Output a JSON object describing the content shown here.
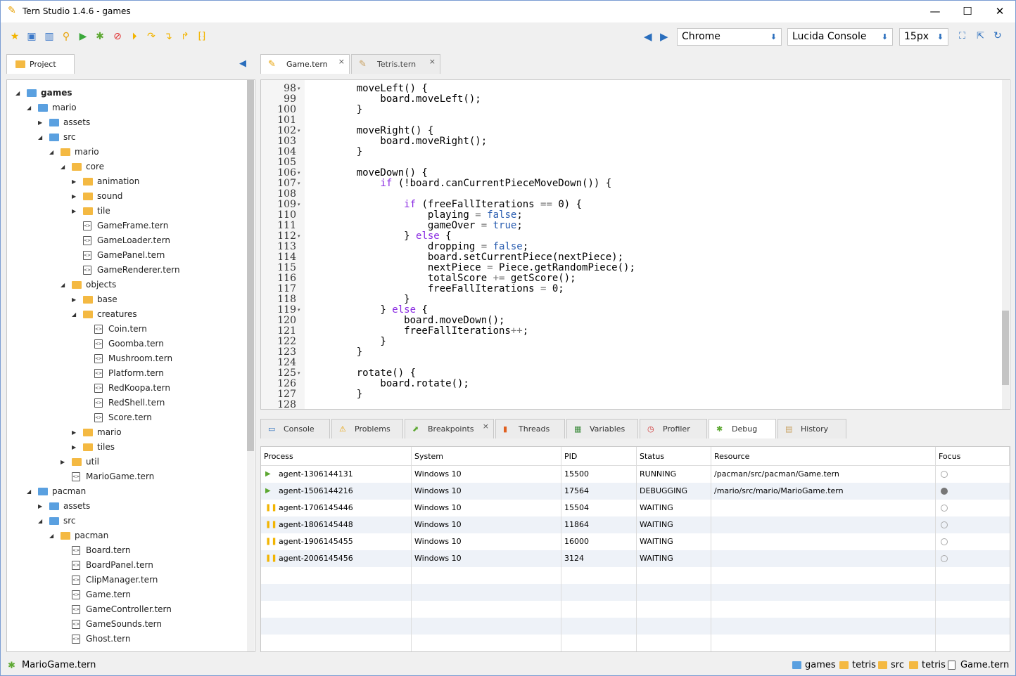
{
  "window": {
    "title": "Tern Studio 1.4.6 - games",
    "minimize": "—",
    "maximize": "☐",
    "close": "✕"
  },
  "toolbar": {
    "browser_select": "Chrome",
    "font_select": "Lucida Console",
    "size_select": "15px"
  },
  "project_panel": {
    "tab_label": "Project"
  },
  "tree": [
    {
      "label": "games",
      "depth": 0,
      "kind": "folder-blue",
      "twisty": "open",
      "bold": true
    },
    {
      "label": "mario",
      "depth": 1,
      "kind": "folder-blue",
      "twisty": "open"
    },
    {
      "label": "assets",
      "depth": 2,
      "kind": "folder-blue",
      "twisty": "closed"
    },
    {
      "label": "src",
      "depth": 2,
      "kind": "folder-blue",
      "twisty": "open"
    },
    {
      "label": "mario",
      "depth": 3,
      "kind": "folder",
      "twisty": "open"
    },
    {
      "label": "core",
      "depth": 4,
      "kind": "folder",
      "twisty": "open"
    },
    {
      "label": "animation",
      "depth": 5,
      "kind": "folder",
      "twisty": "closed"
    },
    {
      "label": "sound",
      "depth": 5,
      "kind": "folder",
      "twisty": "closed"
    },
    {
      "label": "tile",
      "depth": 5,
      "kind": "folder",
      "twisty": "closed"
    },
    {
      "label": "GameFrame.tern",
      "depth": 5,
      "kind": "file"
    },
    {
      "label": "GameLoader.tern",
      "depth": 5,
      "kind": "file"
    },
    {
      "label": "GamePanel.tern",
      "depth": 5,
      "kind": "file"
    },
    {
      "label": "GameRenderer.tern",
      "depth": 5,
      "kind": "file"
    },
    {
      "label": "objects",
      "depth": 4,
      "kind": "folder",
      "twisty": "open"
    },
    {
      "label": "base",
      "depth": 5,
      "kind": "folder",
      "twisty": "closed"
    },
    {
      "label": "creatures",
      "depth": 5,
      "kind": "folder",
      "twisty": "open"
    },
    {
      "label": "Coin.tern",
      "depth": 6,
      "kind": "file"
    },
    {
      "label": "Goomba.tern",
      "depth": 6,
      "kind": "file"
    },
    {
      "label": "Mushroom.tern",
      "depth": 6,
      "kind": "file"
    },
    {
      "label": "Platform.tern",
      "depth": 6,
      "kind": "file"
    },
    {
      "label": "RedKoopa.tern",
      "depth": 6,
      "kind": "file"
    },
    {
      "label": "RedShell.tern",
      "depth": 6,
      "kind": "file"
    },
    {
      "label": "Score.tern",
      "depth": 6,
      "kind": "file"
    },
    {
      "label": "mario",
      "depth": 5,
      "kind": "folder",
      "twisty": "closed"
    },
    {
      "label": "tiles",
      "depth": 5,
      "kind": "folder",
      "twisty": "closed"
    },
    {
      "label": "util",
      "depth": 4,
      "kind": "folder",
      "twisty": "closed"
    },
    {
      "label": "MarioGame.tern",
      "depth": 4,
      "kind": "file"
    },
    {
      "label": "pacman",
      "depth": 1,
      "kind": "folder-blue",
      "twisty": "open"
    },
    {
      "label": "assets",
      "depth": 2,
      "kind": "folder-blue",
      "twisty": "closed"
    },
    {
      "label": "src",
      "depth": 2,
      "kind": "folder-blue",
      "twisty": "open"
    },
    {
      "label": "pacman",
      "depth": 3,
      "kind": "folder",
      "twisty": "open"
    },
    {
      "label": "Board.tern",
      "depth": 4,
      "kind": "file"
    },
    {
      "label": "BoardPanel.tern",
      "depth": 4,
      "kind": "file"
    },
    {
      "label": "ClipManager.tern",
      "depth": 4,
      "kind": "file"
    },
    {
      "label": "Game.tern",
      "depth": 4,
      "kind": "file"
    },
    {
      "label": "GameController.tern",
      "depth": 4,
      "kind": "file"
    },
    {
      "label": "GameSounds.tern",
      "depth": 4,
      "kind": "file"
    },
    {
      "label": "Ghost.tern",
      "depth": 4,
      "kind": "file"
    }
  ],
  "editor_tabs": [
    {
      "label": "Game.tern",
      "active": true,
      "close": "×"
    },
    {
      "label": "Tetris.tern",
      "active": false,
      "close": "×"
    }
  ],
  "code": [
    {
      "n": "98",
      "fold": true,
      "t": "    moveLeft() {"
    },
    {
      "n": "99",
      "fold": false,
      "t": "        board.moveLeft();"
    },
    {
      "n": "100",
      "fold": false,
      "t": "    }"
    },
    {
      "n": "101",
      "fold": false,
      "t": ""
    },
    {
      "n": "102",
      "fold": true,
      "t": "    moveRight() {"
    },
    {
      "n": "103",
      "fold": false,
      "t": "        board.moveRight();"
    },
    {
      "n": "104",
      "fold": false,
      "t": "    }"
    },
    {
      "n": "105",
      "fold": false,
      "t": ""
    },
    {
      "n": "106",
      "fold": true,
      "t": "    moveDown() {"
    },
    {
      "n": "107",
      "fold": true,
      "t": "        if (!board.canCurrentPieceMoveDown()) {"
    },
    {
      "n": "108",
      "fold": false,
      "t": ""
    },
    {
      "n": "109",
      "fold": true,
      "t": "            if (freeFallIterations == 0) {"
    },
    {
      "n": "110",
      "fold": false,
      "t": "                playing = false;"
    },
    {
      "n": "111",
      "fold": false,
      "t": "                gameOver = true;"
    },
    {
      "n": "112",
      "fold": true,
      "t": "            } else {"
    },
    {
      "n": "113",
      "fold": false,
      "t": "                dropping = false;"
    },
    {
      "n": "114",
      "fold": false,
      "t": "                board.setCurrentPiece(nextPiece);"
    },
    {
      "n": "115",
      "fold": false,
      "t": "                nextPiece = Piece.getRandomPiece();"
    },
    {
      "n": "116",
      "fold": false,
      "t": "                totalScore += getScore();"
    },
    {
      "n": "117",
      "fold": false,
      "t": "                freeFallIterations = 0;"
    },
    {
      "n": "118",
      "fold": false,
      "t": "            }"
    },
    {
      "n": "119",
      "fold": true,
      "t": "        } else {"
    },
    {
      "n": "120",
      "fold": false,
      "t": "            board.moveDown();"
    },
    {
      "n": "121",
      "fold": false,
      "t": "            freeFallIterations++;"
    },
    {
      "n": "122",
      "fold": false,
      "t": "        }"
    },
    {
      "n": "123",
      "fold": false,
      "t": "    }"
    },
    {
      "n": "124",
      "fold": false,
      "t": ""
    },
    {
      "n": "125",
      "fold": true,
      "t": "    rotate() {"
    },
    {
      "n": "126",
      "fold": false,
      "t": "        board.rotate();"
    },
    {
      "n": "127",
      "fold": false,
      "t": "    }"
    },
    {
      "n": "128",
      "fold": false,
      "t": ""
    }
  ],
  "bottom_tabs": [
    {
      "label": "Console",
      "icon": "console-icon",
      "active": false
    },
    {
      "label": "Problems",
      "icon": "warning-icon",
      "active": false
    },
    {
      "label": "Breakpoints",
      "icon": "pin-icon",
      "active": false,
      "close": "×"
    },
    {
      "label": "Threads",
      "icon": "threads-icon",
      "active": false
    },
    {
      "label": "Variables",
      "icon": "grid-icon",
      "active": false
    },
    {
      "label": "Profiler",
      "icon": "clock-icon",
      "active": false
    },
    {
      "label": "Debug",
      "icon": "bug-icon",
      "active": true
    },
    {
      "label": "History",
      "icon": "history-icon",
      "active": false
    }
  ],
  "debug_table": {
    "columns": [
      "Process",
      "System",
      "PID",
      "Status",
      "Resource",
      "Focus"
    ],
    "rows": [
      {
        "state": "running",
        "process": "agent-1306144131",
        "system": "Windows 10",
        "pid": "15500",
        "status": "RUNNING",
        "resource": "/pacman/src/pacman/Game.tern",
        "focus": false
      },
      {
        "state": "debugging",
        "process": "agent-1506144216",
        "system": "Windows 10",
        "pid": "17564",
        "status": "DEBUGGING",
        "resource": "/mario/src/mario/MarioGame.tern",
        "focus": true
      },
      {
        "state": "waiting",
        "process": "agent-1706145446",
        "system": "Windows 10",
        "pid": "15504",
        "status": "WAITING",
        "resource": "",
        "focus": false
      },
      {
        "state": "waiting",
        "process": "agent-1806145448",
        "system": "Windows 10",
        "pid": "11864",
        "status": "WAITING",
        "resource": "",
        "focus": false
      },
      {
        "state": "waiting",
        "process": "agent-1906145455",
        "system": "Windows 10",
        "pid": "16000",
        "status": "WAITING",
        "resource": "",
        "focus": false
      },
      {
        "state": "waiting",
        "process": "agent-2006145456",
        "system": "Windows 10",
        "pid": "3124",
        "status": "WAITING",
        "resource": "",
        "focus": false
      }
    ]
  },
  "status_bar": {
    "file": "MarioGame.tern",
    "breadcrumb": [
      "games",
      "tetris",
      "src",
      "tetris",
      "Game.tern"
    ]
  },
  "colors": {
    "accent": "#2a6ebd",
    "folder": "#f4b942",
    "folder_blue": "#5aa0e0",
    "keyword": "#8a2be2",
    "literal": "#2a5db0",
    "bug_green": "#5da832"
  }
}
